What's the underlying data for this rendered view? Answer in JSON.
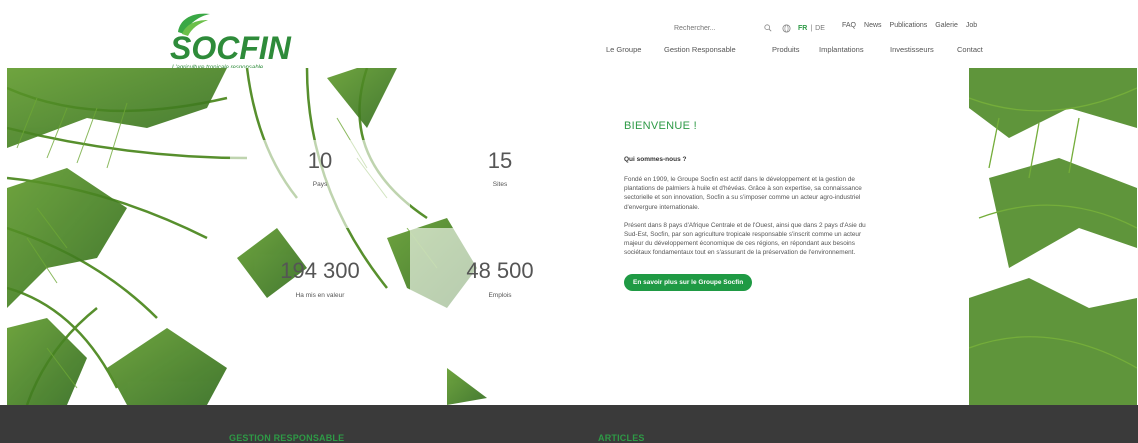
{
  "header": {
    "logo_text": "SOCFIN",
    "logo_tagline": "L'agriculture tropicale responsable",
    "search": {
      "placeholder": "Rechercher..."
    },
    "languages": {
      "active": "FR",
      "separator": "|",
      "other": "DE"
    },
    "util_links": [
      "FAQ",
      "News",
      "Publications",
      "Galerie",
      "Job"
    ],
    "nav": [
      "Le Groupe",
      "Gestion Responsable",
      "Produits",
      "Implantations",
      "Investisseurs",
      "Contact"
    ]
  },
  "stats": [
    {
      "value": "10",
      "label": "Pays"
    },
    {
      "value": "15",
      "label": "Sites"
    },
    {
      "value": "194 300",
      "label": "Ha mis en valeur"
    },
    {
      "value": "48 500",
      "label": "Emplois"
    }
  ],
  "welcome": {
    "title": "BIENVENUE !",
    "subtitle": "Qui sommes-nous ?",
    "paragraph1": "Fondé en 1909, le Groupe Socfin est actif dans le développement et la gestion de plantations de palmiers à huile et d'hévéas. Grâce à son expertise, sa connaissance sectorielle et son innovation, Socfin a su s'imposer comme un acteur agro-industriel d'envergure internationale.",
    "paragraph2": "Présent dans 8 pays d'Afrique Centrale et de l'Ouest, ainsi que dans 2 pays d'Asie du Sud-Est, Socfin, par son agriculture tropicale responsable s'inscrit comme un acteur majeur du développement économique de ces régions, en répondant aux besoins sociétaux fondamentaux tout en s'assurant de la préservation de l'environnement.",
    "cta_label": "En savoir plus sur le Groupe Socfin"
  },
  "footer": {
    "section1": "GESTION RESPONSABLE",
    "section2": "ARTICLES"
  },
  "colors": {
    "brand_green": "#2e9a46",
    "footer_bg": "#3a3a3a"
  }
}
